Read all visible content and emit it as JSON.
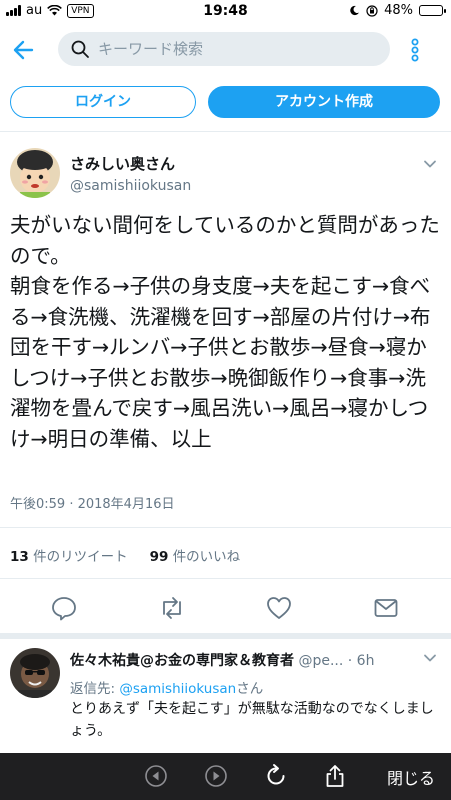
{
  "status_bar": {
    "carrier": "au",
    "vpn": "VPN",
    "time": "19:48",
    "battery": "48%"
  },
  "search": {
    "placeholder": "キーワード検索"
  },
  "buttons": {
    "login": "ログイン",
    "signup": "アカウント作成"
  },
  "tweet": {
    "display_name": "さみしい奥さん",
    "handle": "@samishiiokusan",
    "text": "夫がいない間何をしているのかと質問があったので。\n朝食を作る→子供の身支度→夫を起こす→食べる→食洗機、洗濯機を回す→部屋の片付け→布団を干す→ルンバ→子供とお散歩→昼食→寝かしつけ→子供とお散歩→晩御飯作り→食事→洗濯物を畳んで戻す→風呂洗い→風呂→寝かしつけ→明日の準備、以上",
    "timestamp": "午後0:59 · 2018年4月16日",
    "retweet_count": "13",
    "retweet_label": "件のリツイート",
    "like_count": "99",
    "like_label": "件のいいね"
  },
  "reply": {
    "display_name": "佐々木祐貴@お金の専門家＆教育者",
    "handle": "@pe...",
    "time": "· 6h",
    "reply_prefix": "返信先: ",
    "reply_mention": "@samishiiokusan",
    "reply_suffix": "さん",
    "text": "とりあえず「夫を起こす」が無駄な活動なのでなくしましょう。"
  },
  "toolbar": {
    "close": "閉じる"
  },
  "colors": {
    "accent": "#1da1f2",
    "text": "#14171a",
    "muted": "#657786",
    "toolbar_bg": "#1f1f21"
  },
  "icons": [
    "signal-icon",
    "wifi-icon",
    "lock-rotation-icon",
    "alarm-icon",
    "battery-icon",
    "back-arrow-icon",
    "search-icon",
    "more-vertical-icon",
    "chevron-down-icon",
    "reply-icon",
    "retweet-icon",
    "like-icon",
    "message-icon",
    "browser-back-icon",
    "browser-forward-icon",
    "reload-icon",
    "share-icon"
  ]
}
